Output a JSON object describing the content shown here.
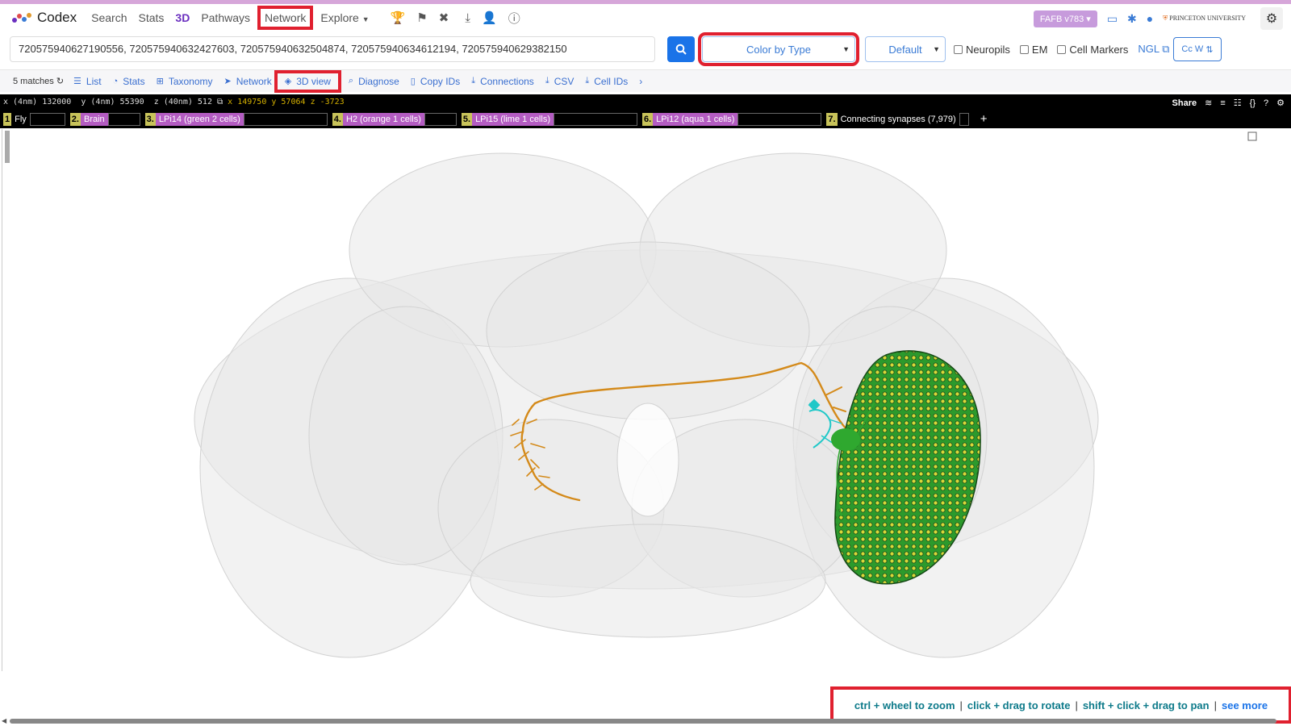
{
  "brand": {
    "name": "Codex"
  },
  "nav": {
    "links": [
      "Search",
      "Stats",
      "3D",
      "Pathways",
      "Network",
      "Explore"
    ],
    "version": "FAFB v783",
    "institution": "PRINCETON UNIVERSITY"
  },
  "search": {
    "value": "720575940627190556, 720575940632427603, 720575940632504874, 720575940634612194, 720575940629382150"
  },
  "controls": {
    "color_select": "Color by Type",
    "style_select": "Default",
    "checkboxes": [
      "Neuropils",
      "EM",
      "Cell Markers"
    ],
    "ngl": "NGL",
    "ccw": "Cc W"
  },
  "toolbar": {
    "matches": "5 matches",
    "tools": [
      "List",
      "Stats",
      "Taxonomy",
      "Network",
      "3D view",
      "Diagnose",
      "Copy IDs",
      "Connections",
      "CSV",
      "Cell IDs"
    ]
  },
  "neuroglancer": {
    "coords": {
      "x_label": "x (4nm)",
      "x_val": "132000",
      "y_label": "y (4nm)",
      "y_val": "55390",
      "z_label": "z (40nm)",
      "z_val": "512",
      "mouse_x": "x 149750",
      "mouse_y": "y 57064",
      "mouse_z": "z -3723"
    },
    "share": "Share",
    "layers": [
      {
        "num": "1",
        "label": "Fly"
      },
      {
        "num": "2.",
        "label": "Brain"
      },
      {
        "num": "3.",
        "label": "LPi14 (green 2 cells)"
      },
      {
        "num": "4.",
        "label": "H2 (orange 1 cells)"
      },
      {
        "num": "5.",
        "label": "LPi15 (lime 1 cells)"
      },
      {
        "num": "6.",
        "label": "LPi12 (aqua 1 cells)"
      },
      {
        "num": "7.",
        "label": "Connecting synapses (7,979)"
      }
    ]
  },
  "help": {
    "zoom": "ctrl + wheel to zoom",
    "rotate": "click + drag to rotate",
    "pan": "shift + click + drag to pan",
    "more": "see more"
  },
  "colors": {
    "accent": "#1a73e8",
    "highlight": "#e0202f",
    "layer_purple": "#b45cc2",
    "neuron_orange": "#d48a1a",
    "neuron_green": "#2fa82f",
    "neuron_aqua": "#1fc8c8"
  }
}
